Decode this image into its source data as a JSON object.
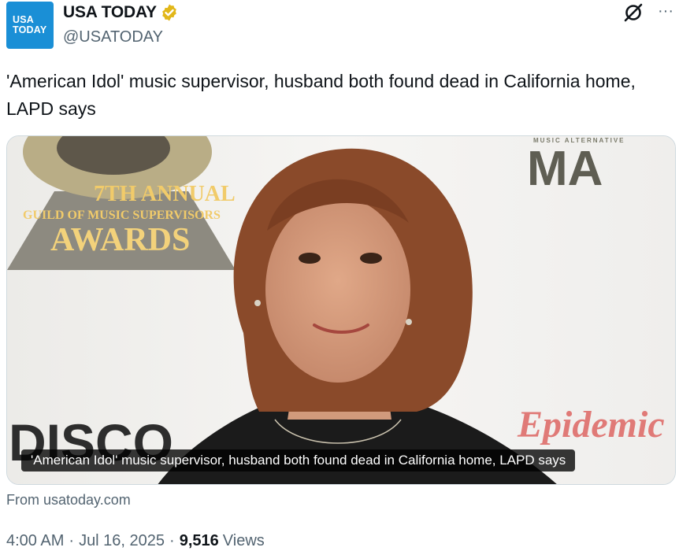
{
  "author": {
    "avatar_line1": "USA",
    "avatar_line2": "TODAY",
    "display_name": "USA TODAY",
    "handle": "@USATODAY",
    "verified_color": "#e2b719"
  },
  "header_icons": {
    "grok": "grok-icon",
    "more": "more-icon",
    "more_glyph": "···"
  },
  "tweet": {
    "text": "'American Idol' music supervisor, husband both found dead in California home, LAPD says"
  },
  "card": {
    "caption": "'American Idol' music supervisor, husband both found dead in California home, LAPD says",
    "image_text": {
      "award_annual": "7TH ANNUAL",
      "award_guild": "GUILD OF MUSIC SUPERVISORS",
      "award_title": "AWARDS",
      "top_right_small": "MUSIC ALTERNATIVE",
      "top_right_big": "MA",
      "bottom_left": "DISCO",
      "bottom_right": "Epidemic"
    },
    "source": "From usatoday.com"
  },
  "meta": {
    "time": "4:00 AM",
    "date": "Jul 16, 2025",
    "views_count": "9,516",
    "views_label": "Views",
    "separator": "·"
  },
  "colors": {
    "text_primary": "#0f1419",
    "text_secondary": "#536471",
    "brand": "#1a8fd6"
  }
}
